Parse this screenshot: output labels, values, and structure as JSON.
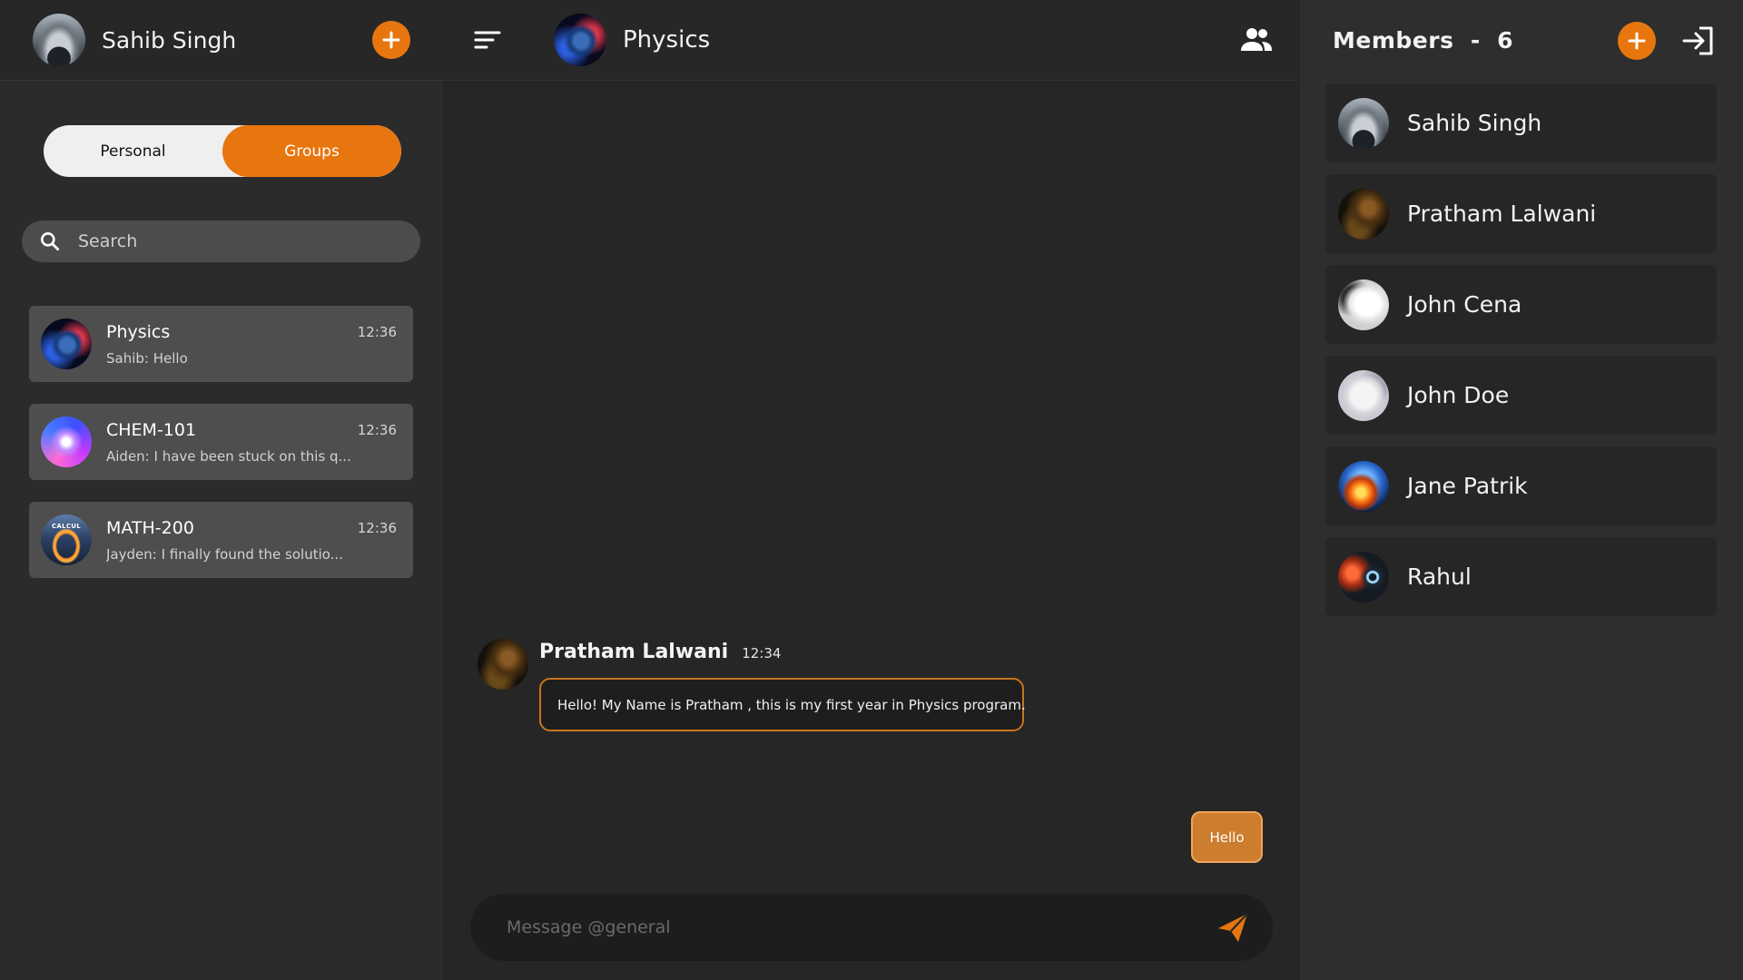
{
  "user": {
    "name": "Sahib Singh",
    "avatar_icon": "car-avatar"
  },
  "toggle": {
    "personal": "Personal",
    "groups": "Groups",
    "active": "Groups"
  },
  "search": {
    "placeholder": "Search"
  },
  "chats": [
    {
      "name": "Physics",
      "time": "12:36",
      "preview": "Sahib: Hello",
      "avatar_icon": "earth-avatar"
    },
    {
      "name": "CHEM-101",
      "time": "12:36",
      "preview": "Aiden: I have been stuck on this q...",
      "avatar_icon": "atom-avatar"
    },
    {
      "name": "MATH-200",
      "time": "12:36",
      "preview": "Jayden: I finally found the solutio...",
      "avatar_icon": "calculus-avatar",
      "avatar_text": "CALCUL"
    }
  ],
  "group": {
    "name": "Physics",
    "avatar_icon": "earth-avatar"
  },
  "messages": [
    {
      "author": "Pratham Lalwani",
      "time": "12:34",
      "text": "Hello! My Name is Pratham , this is my first year in Physics program."
    }
  ],
  "my_message": {
    "text": "Hello"
  },
  "composer": {
    "placeholder": "Message @general"
  },
  "members_panel": {
    "title": "Members  -  6"
  },
  "members": [
    {
      "name": "Sahib Singh",
      "avatar_icon": "car-avatar"
    },
    {
      "name": "Pratham Lalwani",
      "avatar_icon": "portrait-avatar"
    },
    {
      "name": "John Cena",
      "avatar_icon": "sketch-avatar"
    },
    {
      "name": "John Doe",
      "avatar_icon": "sketch-avatar"
    },
    {
      "name": "Jane Patrik",
      "avatar_icon": "fire-planet-avatar"
    },
    {
      "name": "Rahul",
      "avatar_icon": "tech-avatar"
    }
  ],
  "colors": {
    "accent": "#e8760f",
    "bubble_border": "#c9741e",
    "my_bubble": "#cc7d2e",
    "panel": "#2b2b2b",
    "card": "#4e4e4e"
  }
}
